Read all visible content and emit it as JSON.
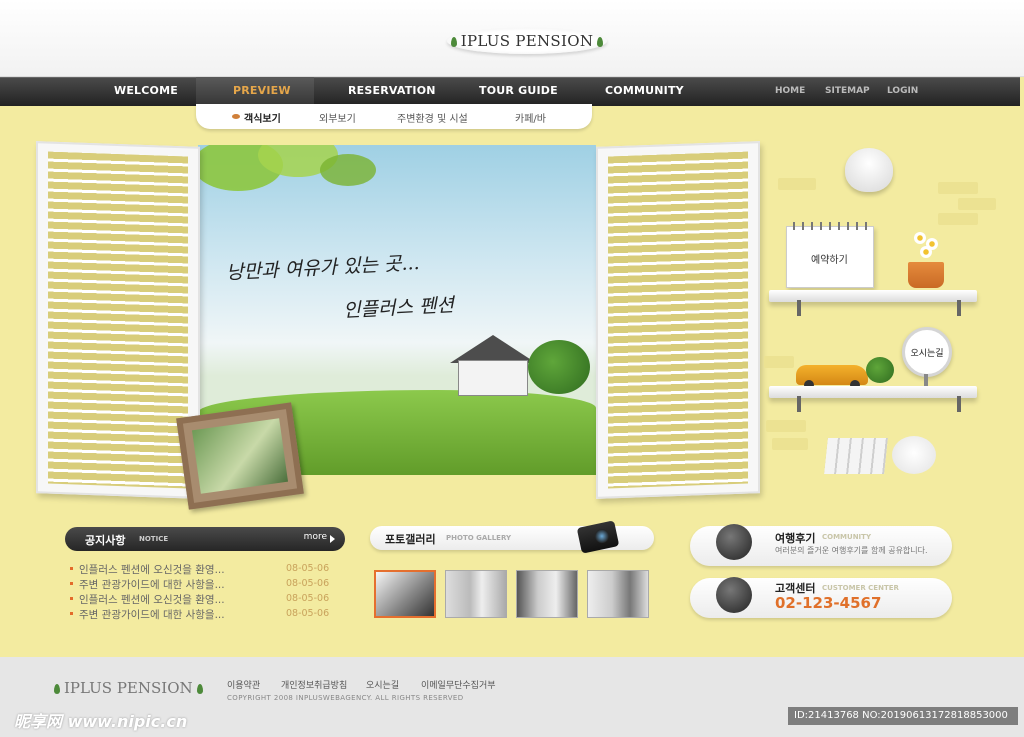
{
  "brand": {
    "logo": "IPLUS PENSION"
  },
  "nav": {
    "items": [
      {
        "label": "WELCOME",
        "active": false
      },
      {
        "label": "PREVIEW",
        "active": true
      },
      {
        "label": "RESERVATION",
        "active": false
      },
      {
        "label": "TOUR GUIDE",
        "active": false
      },
      {
        "label": "COMMUNITY",
        "active": false
      }
    ],
    "util": [
      "HOME",
      "SITEMAP",
      "LOGIN"
    ]
  },
  "subnav": {
    "items": [
      {
        "label": "객식보기",
        "active": true
      },
      {
        "label": "외부보기",
        "active": false
      },
      {
        "label": "주변환경 및 시설",
        "active": false
      },
      {
        "label": "카페/바",
        "active": false
      }
    ]
  },
  "hero": {
    "slogan_line1": "낭만과 여유가 있는 곳...",
    "slogan_line2": "인플러스 펜션"
  },
  "shelf": {
    "reserve_label": "예약하기",
    "directions_label": "오시는길"
  },
  "notice": {
    "title": "공지사항",
    "subtitle": "NOTICE",
    "more": "more",
    "items": [
      {
        "title": "인플러스 펜션에 오신것을 환영...",
        "date": "08-05-06"
      },
      {
        "title": "주변 관광가이드에 대한 사항을...",
        "date": "08-05-06"
      },
      {
        "title": "인플러스 펜션에 오신것을 환영...",
        "date": "08-05-06"
      },
      {
        "title": "주변 관광가이드에 대한 사항을...",
        "date": "08-05-06"
      }
    ]
  },
  "gallery": {
    "title": "포토갤러리",
    "subtitle": "PHOTO GALLERY"
  },
  "community": {
    "title": "여행후기",
    "subtitle": "COMMUNITY",
    "desc": "여러분의 즐거운 여행후기를 함께 공유합니다."
  },
  "customer": {
    "title": "고객센터",
    "subtitle": "CUSTOMER CENTER",
    "phone": "02-123-4567"
  },
  "footer": {
    "logo": "IPLUS PENSION",
    "links": [
      "이용약관",
      "개인정보취급방침",
      "오시는길",
      "이메일무단수집거부"
    ],
    "copyright": "COPYRIGHT 2008 INPLUSWEBAGENCY. ALL RIGHTS RESERVED"
  },
  "watermark": {
    "left": "昵享网 www.nipic.cn",
    "right": "ID:21413768 NO:20190613172818853000"
  },
  "colors": {
    "accent": "#e5a64a",
    "phone": "#e0702a",
    "background": "#f3eba0",
    "navbar": "#2b2b2b"
  }
}
